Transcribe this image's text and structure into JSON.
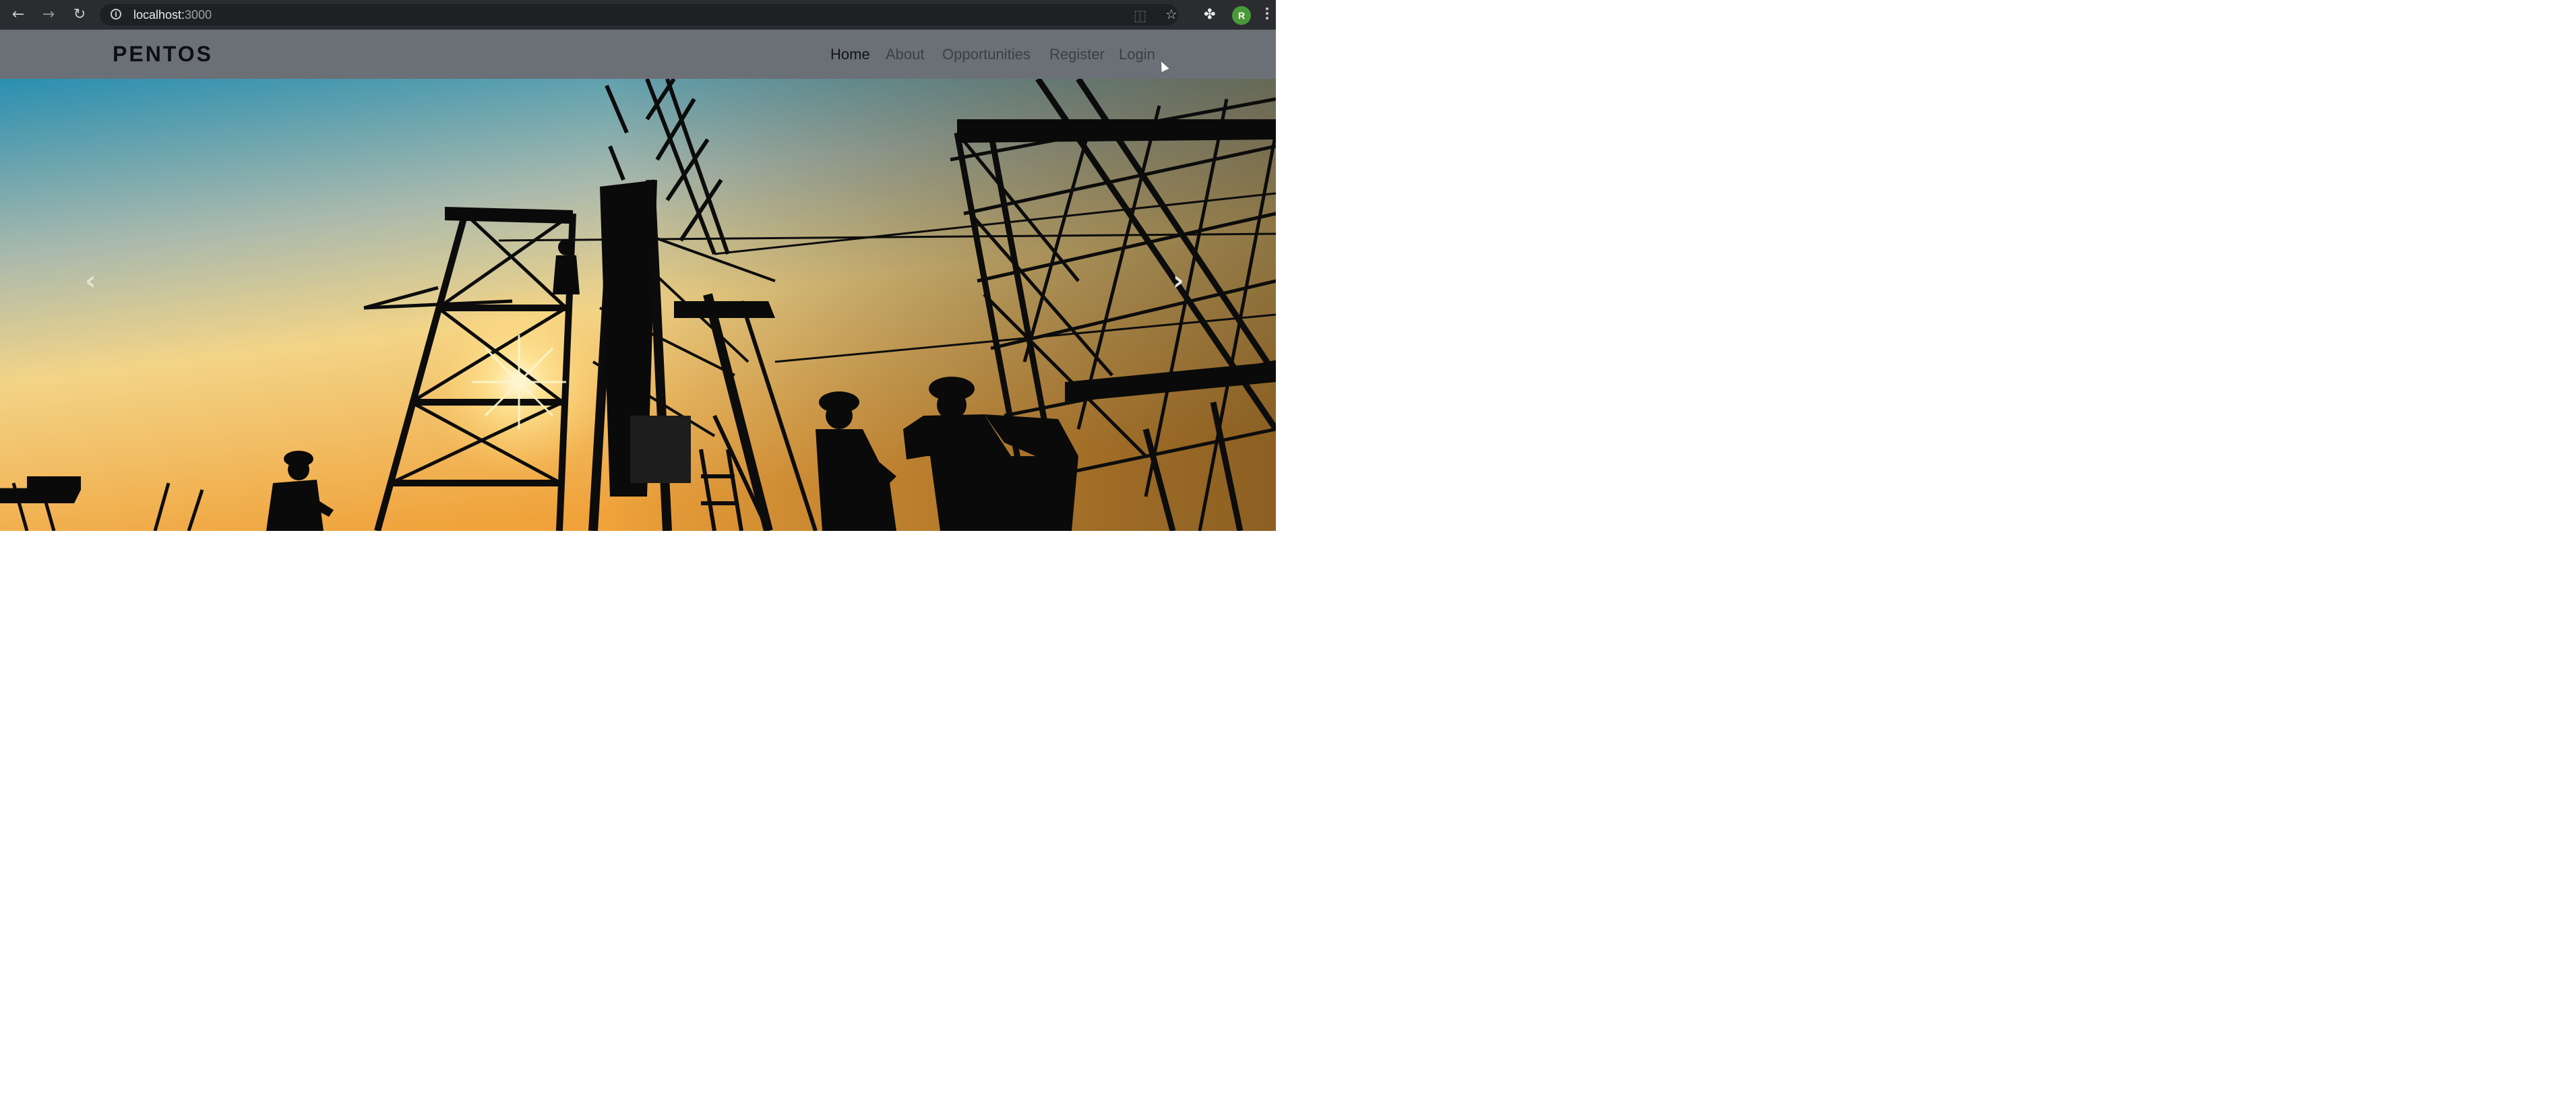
{
  "browser": {
    "url_host": "localhost:",
    "url_port": "3000",
    "icons": [
      "back-arrow-icon",
      "forward-arrow-icon",
      "reload-icon",
      "info-icon",
      "translate-icon",
      "star-icon",
      "extensions-icon",
      "kebab-menu-icon"
    ],
    "glyphs": {
      "back": "←",
      "forward": "→",
      "reload": "↻",
      "info": "i",
      "translate": "⿰",
      "star": "☆",
      "extensions": "✤"
    },
    "profile_initial": "R",
    "profile_color": "#4a9a3a"
  },
  "site": {
    "brand": "PENTOS",
    "nav": [
      {
        "label": "Home",
        "active": true
      },
      {
        "label": "About"
      },
      {
        "label": "Opportunities"
      },
      {
        "label": "Register"
      },
      {
        "label": "Login"
      }
    ],
    "navbar_color": "#6b7077"
  },
  "hero": {
    "image": "construction-silhouette-photo",
    "prev_glyph": "‹",
    "next_glyph": "›"
  }
}
